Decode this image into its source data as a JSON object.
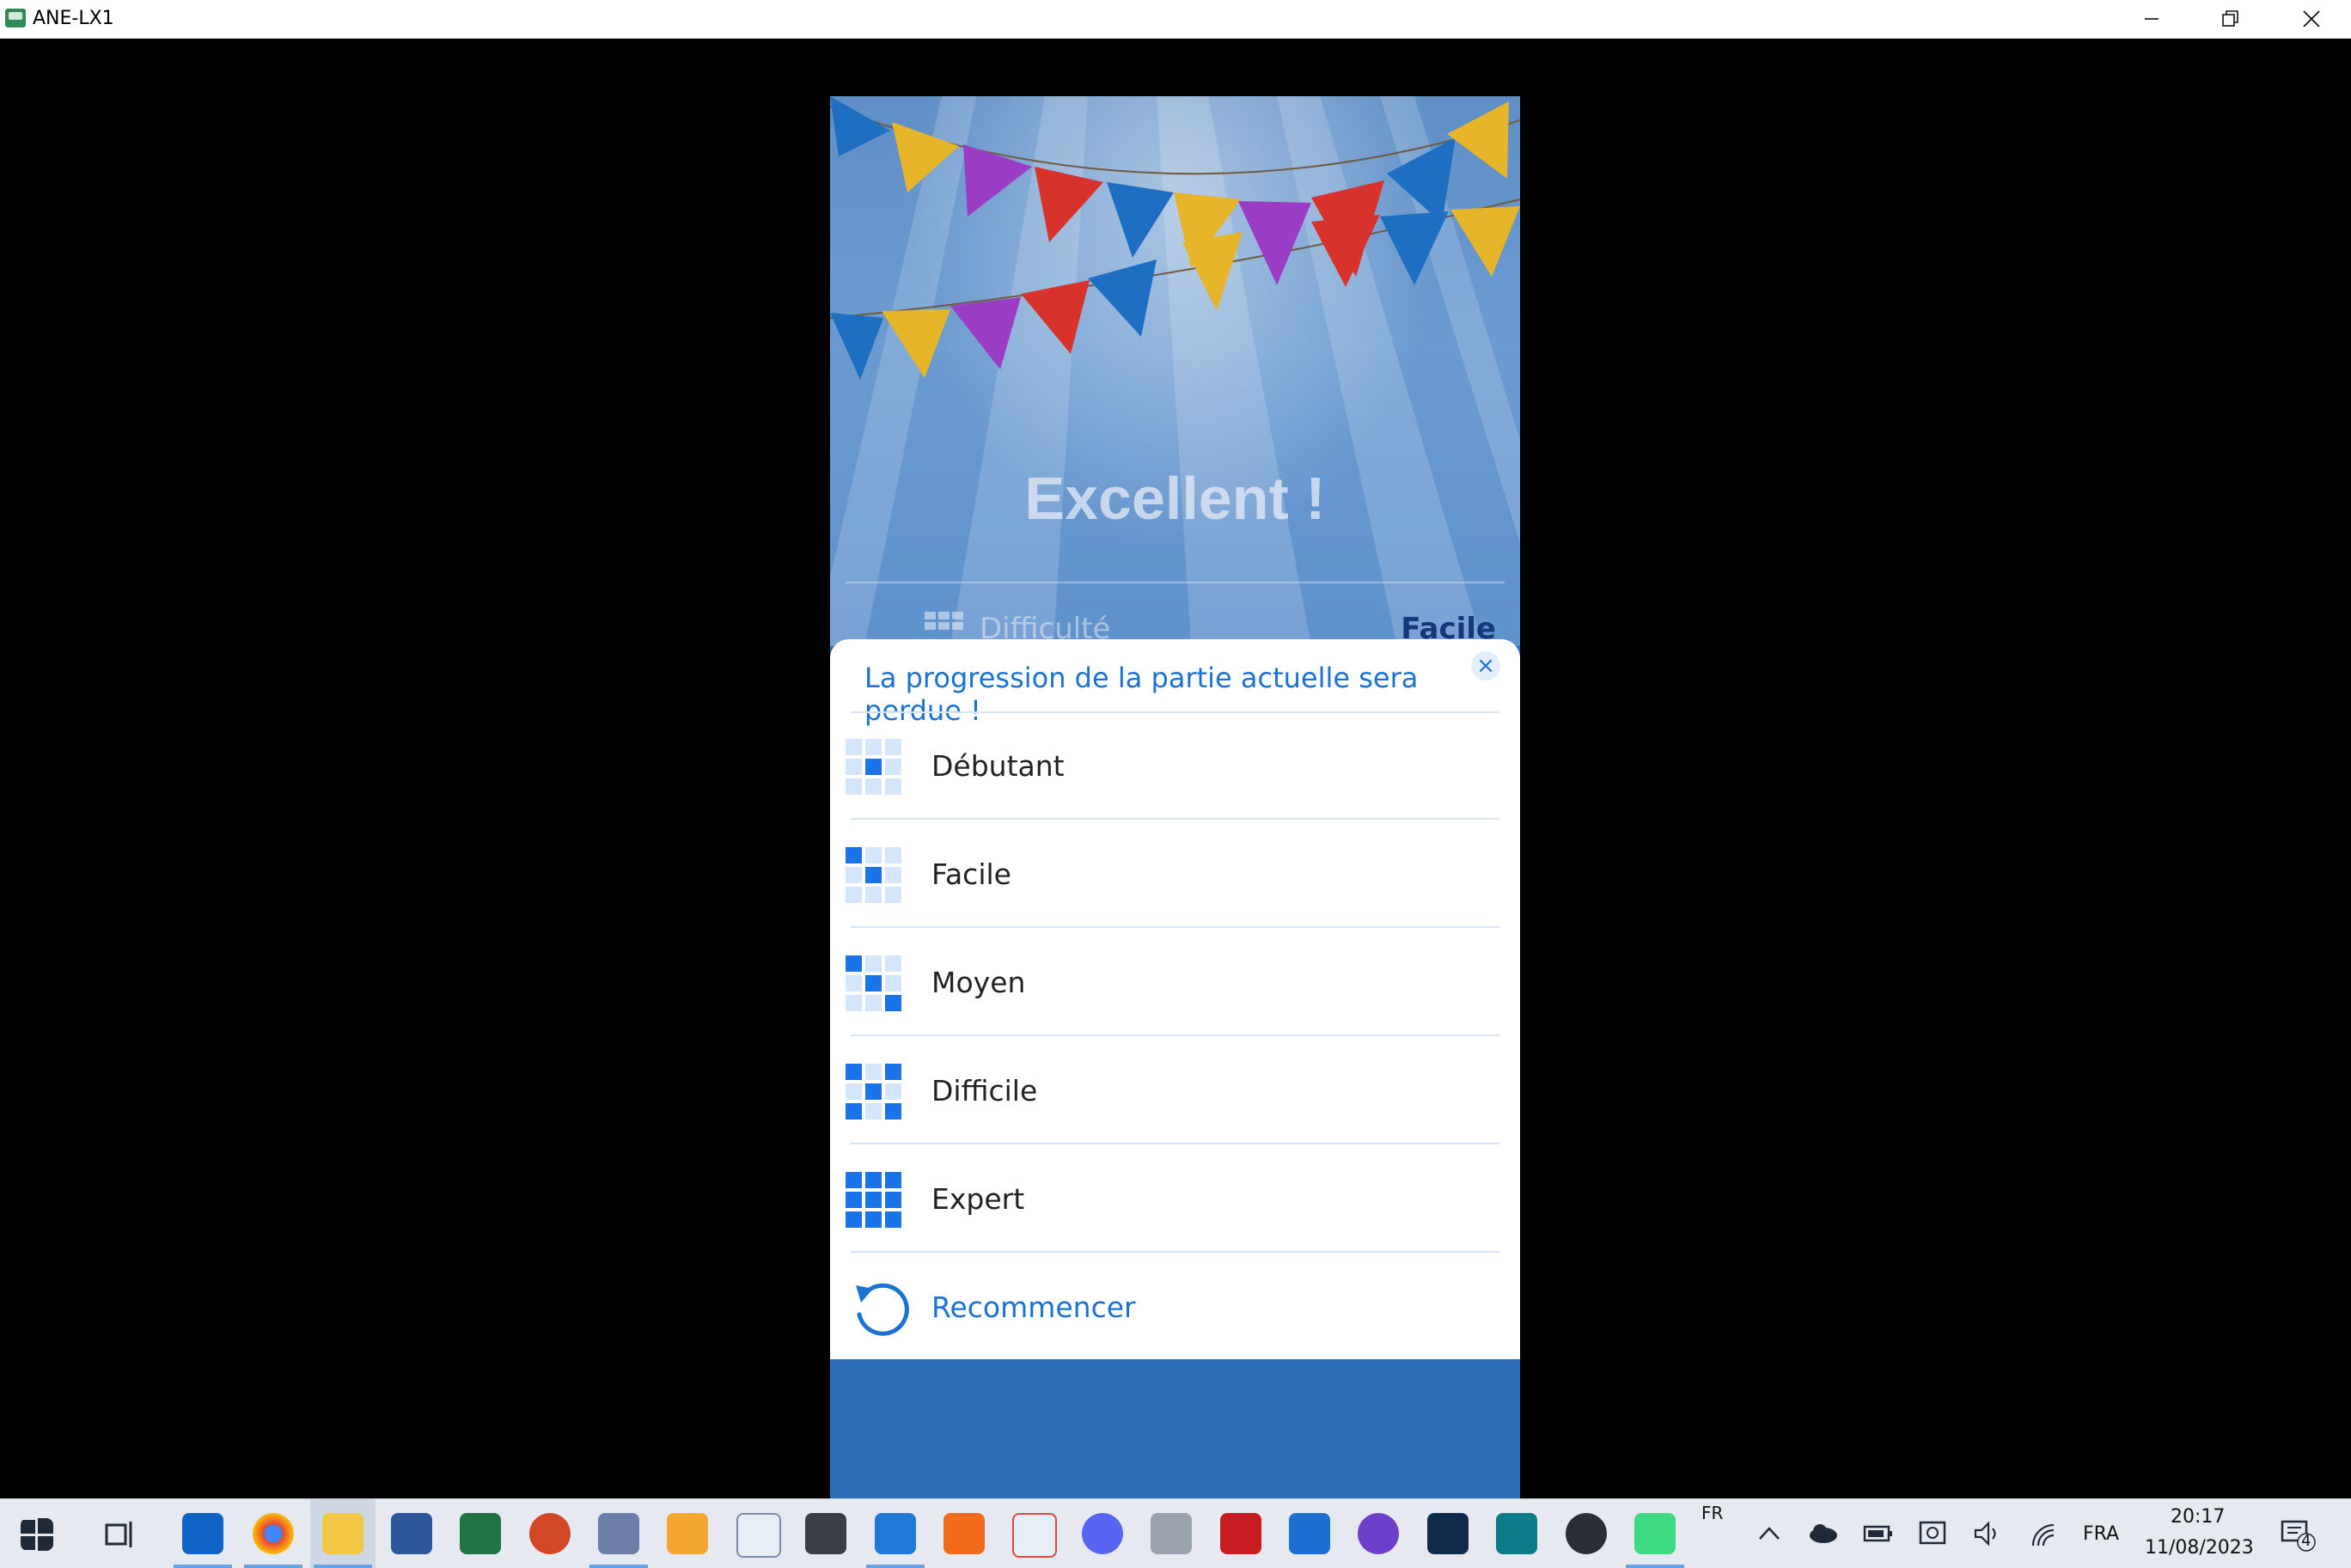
{
  "window": {
    "title": "ANE-LX1",
    "controls": [
      "minimize",
      "restore",
      "close"
    ]
  },
  "game": {
    "congrats": "Excellent !",
    "difficulty_label": "Difficulté",
    "difficulty_value": "Facile"
  },
  "sheet": {
    "message": "La progression de la partie actuelle sera perdue !",
    "close_glyph": "×",
    "options": [
      {
        "label": "Débutant",
        "icon": "grid-level-1-icon"
      },
      {
        "label": "Facile",
        "icon": "grid-level-2-icon"
      },
      {
        "label": "Moyen",
        "icon": "grid-level-3-icon"
      },
      {
        "label": "Difficile",
        "icon": "grid-level-4-icon"
      },
      {
        "label": "Expert",
        "icon": "grid-level-5-icon"
      }
    ],
    "restart_label": "Recommencer"
  },
  "taskbar": {
    "language_input": "FR",
    "language": "FRA",
    "time": "20:17",
    "date": "11/08/2023",
    "notifications": "4"
  },
  "colors": {
    "accent": "#1a73d2",
    "grid_on": "#1a73e8",
    "grid_off": "#d5e6fb",
    "bottom_band": "#2d6db6"
  }
}
